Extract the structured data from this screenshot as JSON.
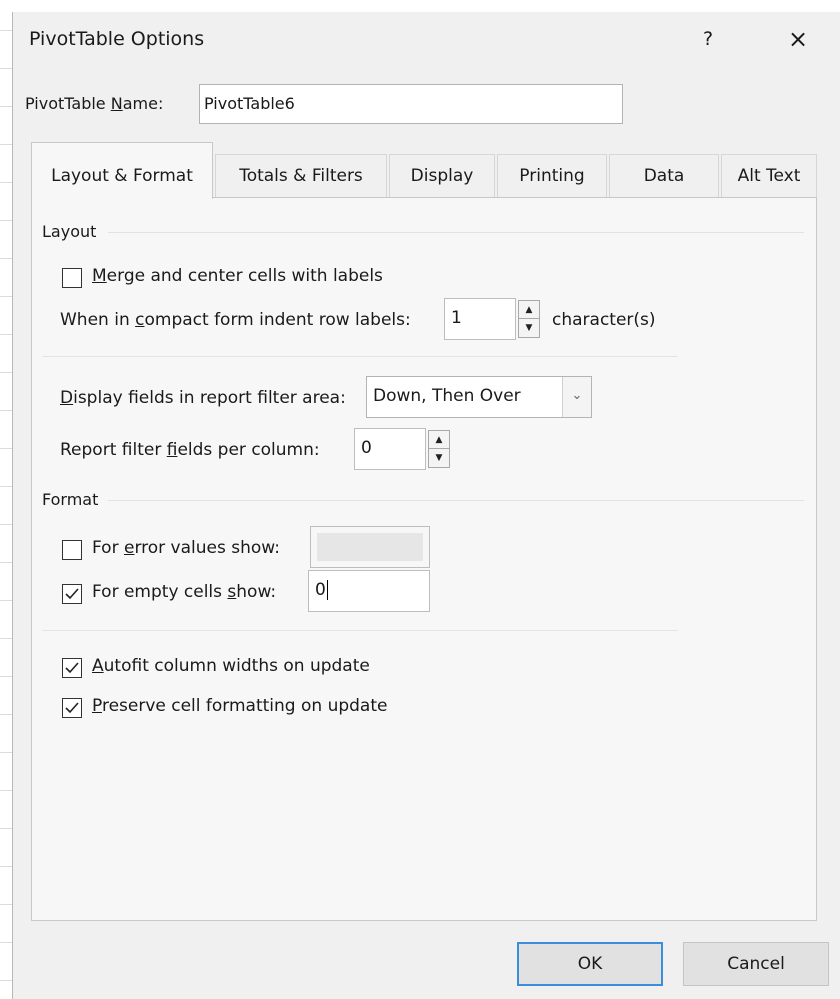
{
  "dialog": {
    "title": "PivotTable Options",
    "help_label": "?",
    "close_label": "×",
    "name_label": "PivotTable Name:",
    "name_value": "PivotTable6"
  },
  "tabs": [
    {
      "label": "Layout & Format",
      "active": true
    },
    {
      "label": "Totals & Filters",
      "active": false
    },
    {
      "label": "Display",
      "active": false
    },
    {
      "label": "Printing",
      "active": false
    },
    {
      "label": "Data",
      "active": false
    },
    {
      "label": "Alt Text",
      "active": false
    }
  ],
  "layout_section": {
    "heading": "Layout",
    "merge_center": {
      "label": "Merge and center cells with labels",
      "checked": false
    },
    "indent_label": "When in compact form indent row labels:",
    "indent_value": "1",
    "indent_unit": "character(s)",
    "filter_area_label": "Display fields in report filter area:",
    "filter_area_value": "Down, Then Over",
    "fields_per_column_label": "Report filter fields per column:",
    "fields_per_column_value": "0"
  },
  "format_section": {
    "heading": "Format",
    "error_values": {
      "label": "For error values show:",
      "checked": false,
      "value": ""
    },
    "empty_cells": {
      "label": "For empty cells show:",
      "checked": true,
      "value": "0"
    },
    "autofit": {
      "label": "Autofit column widths on update",
      "checked": true
    },
    "preserve": {
      "label": "Preserve cell formatting on update",
      "checked": true
    }
  },
  "buttons": {
    "ok": "OK",
    "cancel": "Cancel"
  },
  "icons": {
    "spin_up": "spin-up-icon",
    "spin_down": "spin-down-icon",
    "dropdown": "chevron-down-icon",
    "check": "check-icon"
  },
  "colors": {
    "focus_border": "#3c8ddc",
    "dialog_bg": "#f0f0f0",
    "panel_bg": "#f7f7f7"
  }
}
